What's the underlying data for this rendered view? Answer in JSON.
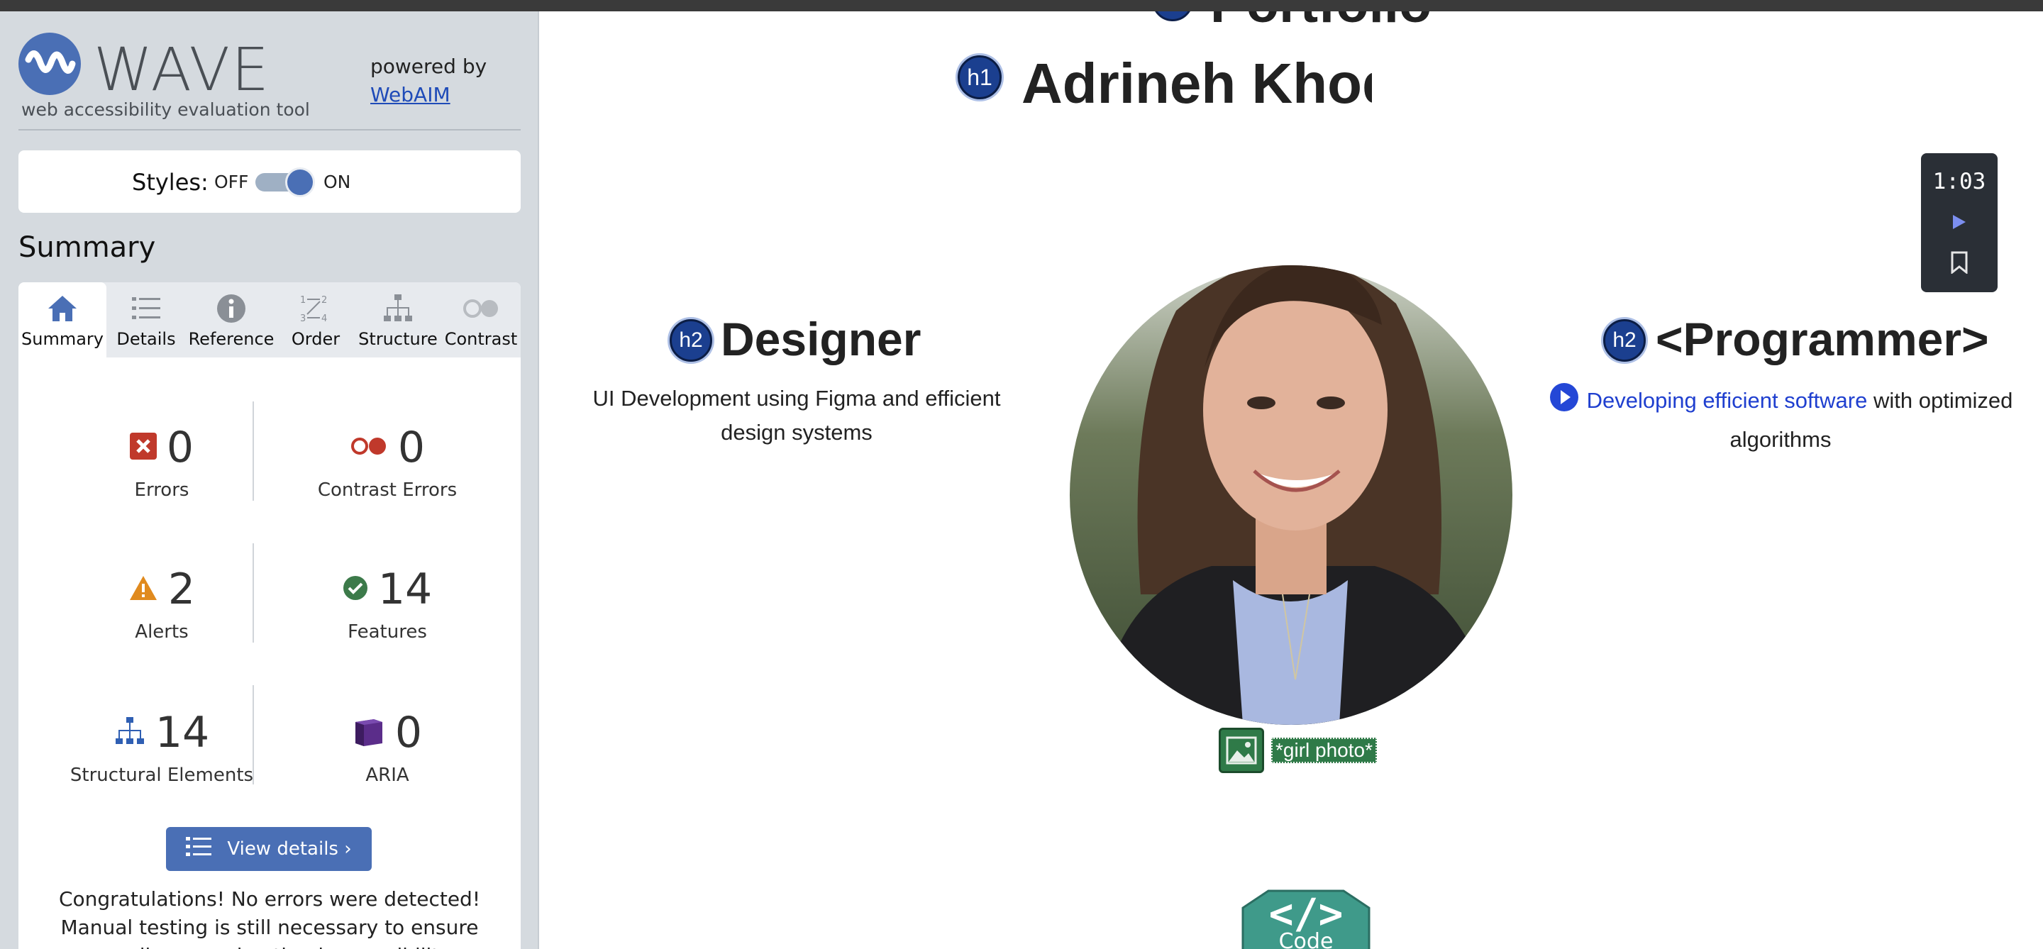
{
  "wave": {
    "brand": "WAVE",
    "tagline": "web accessibility evaluation tool",
    "powered_by": "powered by",
    "webaim_link": "WebAIM",
    "styles_label": "Styles:",
    "styles_off": "OFF",
    "styles_on": "ON",
    "styles_state": "on",
    "summary_heading": "Summary",
    "tabs": [
      {
        "label": "Summary",
        "icon": "home-icon",
        "active": true
      },
      {
        "label": "Details",
        "icon": "list-icon",
        "active": false
      },
      {
        "label": "Reference",
        "icon": "info-icon",
        "active": false
      },
      {
        "label": "Order",
        "icon": "order-icon",
        "active": false
      },
      {
        "label": "Structure",
        "icon": "structure-icon",
        "active": false
      },
      {
        "label": "Contrast",
        "icon": "contrast-icon",
        "active": false
      }
    ],
    "stats": {
      "errors": {
        "count": "0",
        "label": "Errors",
        "icon": "error-icon",
        "color": "#c0392b"
      },
      "contrast_errors": {
        "count": "0",
        "label": "Contrast Errors",
        "icon": "contrast-error-icon",
        "color": "#c0392b"
      },
      "alerts": {
        "count": "2",
        "label": "Alerts",
        "icon": "alert-icon",
        "color": "#e08a1e"
      },
      "features": {
        "count": "14",
        "label": "Features",
        "icon": "feature-icon",
        "color": "#3c7a4a"
      },
      "structural": {
        "count": "14",
        "label": "Structural Elements",
        "icon": "structure-icon",
        "color": "#2f5fb3"
      },
      "aria": {
        "count": "0",
        "label": "ARIA",
        "icon": "aria-icon",
        "color": "#5b2d8a"
      }
    },
    "view_details": "View details ›",
    "congrats": "Congratulations! No errors were detected! Manual testing is still necessary to ensure compliance and optimal accessibility."
  },
  "page": {
    "partial_heading": "Portfolio",
    "h1_badge": "h1",
    "h1": "Adrineh Khodaverdi",
    "left": {
      "badge": "h2",
      "title": "Designer",
      "desc": "UI Development using Figma and efficient design systems"
    },
    "right": {
      "badge": "h2",
      "title": "<Programmer>",
      "desc_link": "Developing efficient software",
      "desc_rest": "with optimized algorithms"
    },
    "photo_alt": "*girl photo*",
    "media": {
      "time": "1:03",
      "play_icon": "play-icon",
      "bookmark_icon": "bookmark-icon"
    },
    "code_badge": "Code",
    "code_glyph": "</>"
  },
  "colors": {
    "wave_blue": "#4a6fb5",
    "badge_navy": "#1b3f8f",
    "alt_green": "#2f7a48",
    "code_teal": "#3f9a8a",
    "link_blue": "#1f3fcf"
  }
}
